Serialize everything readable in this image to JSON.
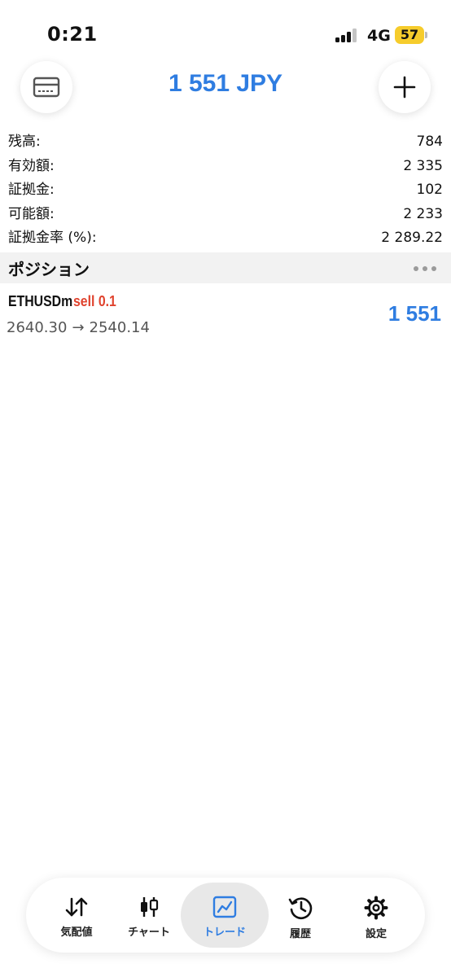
{
  "status_bar": {
    "time": "0:21",
    "network": "4G",
    "battery": "57"
  },
  "header": {
    "title": "1 551 JPY",
    "left_button_icon": "card-icon",
    "right_button_icon": "plus-icon"
  },
  "summary": [
    {
      "label": "残高:",
      "value": "784"
    },
    {
      "label": "有効額:",
      "value": "2 335"
    },
    {
      "label": "証拠金:",
      "value": "102"
    },
    {
      "label": "可能額:",
      "value": "2 233"
    },
    {
      "label": "証拠金率 (%):",
      "value": "2 289.22"
    }
  ],
  "positions_section": {
    "title": "ポジション",
    "more_icon": "more-dots-icon"
  },
  "positions": [
    {
      "symbol": "ETHUSDm",
      "side": "sell 0.1",
      "open_price": "2640.30",
      "arrow": "→",
      "current_price": "2540.14",
      "profit": "1 551"
    }
  ],
  "tabs": [
    {
      "label": "気配値",
      "icon": "quotes-arrows-icon"
    },
    {
      "label": "チャート",
      "icon": "candlestick-icon"
    },
    {
      "label": "トレード",
      "icon": "trade-chart-icon",
      "active": true
    },
    {
      "label": "履歴",
      "icon": "history-icon"
    },
    {
      "label": "設定",
      "icon": "gear-icon"
    }
  ],
  "colors": {
    "accent": "#2f7de1",
    "sell": "#e0432e",
    "battery": "#f6cc2c",
    "section_bg": "#f2f2f2"
  }
}
